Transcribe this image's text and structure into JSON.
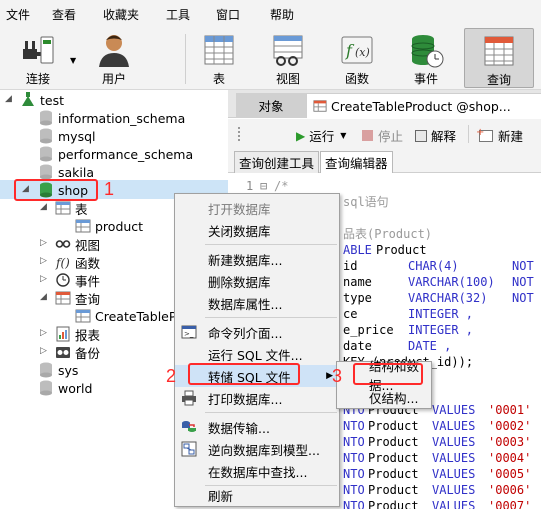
{
  "menubar": [
    "文件",
    "查看",
    "收藏夹",
    "工具",
    "窗口",
    "帮助"
  ],
  "toolbar": {
    "connect": "连接",
    "user": "用户",
    "table": "表",
    "view": "视图",
    "function": "函数",
    "event": "事件",
    "query": "查询"
  },
  "tree": {
    "connection": "test",
    "databases": [
      "information_schema",
      "mysql",
      "performance_schema",
      "sakila"
    ],
    "selected_db": "shop",
    "shop_children": {
      "tables": "表",
      "product": "product",
      "views": "视图",
      "functions": "函数",
      "events": "事件",
      "queries": "查询",
      "query_item": "CreateTablePr",
      "reports": "报表",
      "backups": "备份"
    },
    "after": [
      "sys",
      "world"
    ]
  },
  "tabs": {
    "objects": "对象",
    "query_tab": "CreateTableProduct @shop..."
  },
  "query_toolbar": {
    "run": "运行",
    "stop": "停止",
    "explain": "解释",
    "new": "新建"
  },
  "subtabs": {
    "builder": "查询创建工具",
    "editor": "查询编辑器"
  },
  "editor": {
    "line1_num": "1",
    "line1": "/*",
    "line2": "sql语句",
    "line3": "品表(Product)",
    "line4_kw": "ABLE",
    "line4_name": "Product",
    "rows": [
      {
        "col": "id",
        "type": "CHAR(4)",
        "tail": "NOT"
      },
      {
        "col": "name",
        "type": "VARCHAR(100)",
        "tail": "NOT"
      },
      {
        "col": "type",
        "type": "VARCHAR(32)",
        "tail": "NOT"
      },
      {
        "col": "ce",
        "type": "INTEGER ,",
        "tail": ""
      },
      {
        "col": "e_price",
        "type": "INTEGER ,",
        "tail": ""
      },
      {
        "col": "date",
        "type": "DATE ,",
        "tail": ""
      }
    ],
    "pk_line": "KEY (product_id));",
    "inserts": [
      "'0001'",
      "'0002'",
      "'0003'",
      "'0004'",
      "'0005'",
      "'0006'",
      "'0007'"
    ],
    "insert_prefix": "Product",
    "insert_kw": "VALUES",
    "into_kw": "NTO"
  },
  "context_menu": {
    "open_db": "打开数据库",
    "close_db": "关闭数据库",
    "new_db": "新建数据库...",
    "delete_db": "删除数据库",
    "db_props": "数据库属性...",
    "cmd": "命令列介面...",
    "run_sql": "运行 SQL 文件...",
    "dump_sql": "转储 SQL 文件",
    "print_db": "打印数据库...",
    "transfer": "数据传输...",
    "reverse": "逆向数据库到模型...",
    "find": "在数据库中查找...",
    "refresh": "刷新"
  },
  "submenu": {
    "struct_data": "结构和数据...",
    "struct_only": "仅结构..."
  },
  "annotations": [
    "1",
    "2",
    "3"
  ],
  "colors": {
    "annotation_red": "#ff2a2a",
    "keyword_blue": "#3030c8",
    "string_red": "#c00000",
    "hover_blue": "#cfe3f7"
  }
}
